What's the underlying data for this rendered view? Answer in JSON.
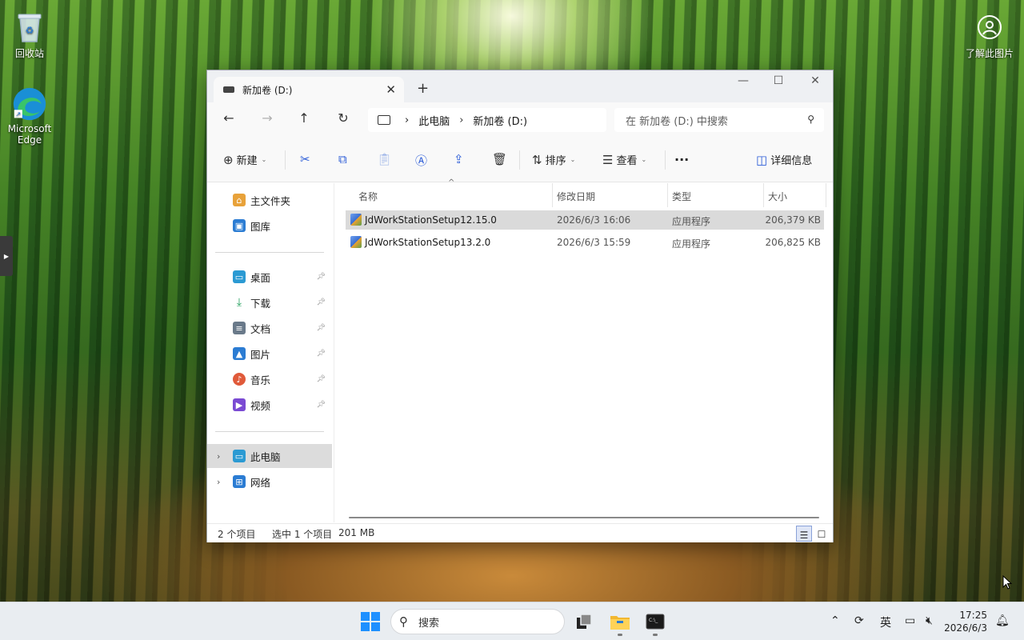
{
  "desktop": {
    "recycle_bin": "回收站",
    "edge": "Microsoft Edge",
    "learn_more": "了解此图片"
  },
  "window": {
    "tab_title": "新加卷 (D:)",
    "breadcrumb": [
      "此电脑",
      "新加卷 (D:)"
    ],
    "search_placeholder": "在 新加卷 (D:) 中搜索"
  },
  "toolbar": {
    "new_label": "新建",
    "sort_label": "排序",
    "view_label": "查看",
    "more_label": "···",
    "details_label": "详细信息"
  },
  "sidebar": {
    "items": [
      {
        "label": "主文件夹",
        "icon": "home-icon",
        "color": "#e8a23a"
      },
      {
        "label": "图库",
        "icon": "gallery-icon",
        "color": "#2b7cd3"
      },
      {
        "label": "桌面",
        "icon": "desktop-icon",
        "color": "#2b9ad3"
      },
      {
        "label": "下载",
        "icon": "download-icon",
        "color": "#1e9e5a"
      },
      {
        "label": "文档",
        "icon": "document-icon",
        "color": "#6a7a8a"
      },
      {
        "label": "图片",
        "icon": "pictures-icon",
        "color": "#2b7cd3"
      },
      {
        "label": "音乐",
        "icon": "music-icon",
        "color": "#e05a3a"
      },
      {
        "label": "视频",
        "icon": "video-icon",
        "color": "#7a4ad3"
      },
      {
        "label": "此电脑",
        "icon": "this-pc-icon",
        "color": "#2b9ad3"
      },
      {
        "label": "网络",
        "icon": "network-icon",
        "color": "#2b7cd3"
      }
    ]
  },
  "filelist": {
    "columns": [
      "名称",
      "修改日期",
      "类型",
      "大小"
    ],
    "rows": [
      {
        "name": "JdWorkStationSetup12.15.0",
        "date": "2026/6/3 16:06",
        "type": "应用程序",
        "size": "206,379 KB"
      },
      {
        "name": "JdWorkStationSetup13.2.0",
        "date": "2026/6/3 15:59",
        "type": "应用程序",
        "size": "206,825 KB"
      }
    ]
  },
  "status": {
    "count": "2 个项目",
    "selected": "选中 1 个项目",
    "size": "201 MB"
  },
  "taskbar": {
    "search_placeholder": "搜索",
    "ime": "英",
    "time": "17:25",
    "date": "2026/6/3"
  }
}
